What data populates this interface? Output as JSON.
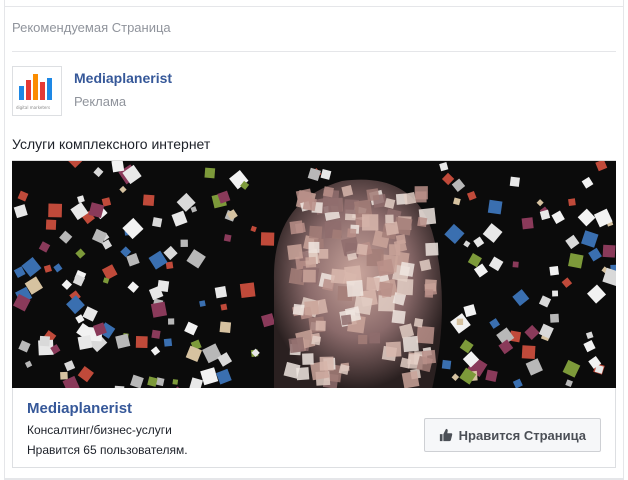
{
  "section": {
    "title": "Рекомендуемая Страница"
  },
  "advertiser": {
    "name": "Mediaplanerist",
    "sponsored_label": "Реклама",
    "logo_tagline": "digital marketers"
  },
  "ad": {
    "text": "Услуги комплексного интернет"
  },
  "footer": {
    "page_name": "Mediaplanerist",
    "category": "Консалтинг/бизнес-услуги",
    "likes_text": "Нравится 65 пользователям.",
    "like_button_label": "Нравится Страница"
  },
  "colors": {
    "link": "#365899",
    "muted": "#90949c",
    "logo_red": "#e53935",
    "logo_blue": "#1e88e5",
    "logo_orange": "#fb8c00"
  },
  "icons": {
    "like": "thumbs-up-icon"
  }
}
